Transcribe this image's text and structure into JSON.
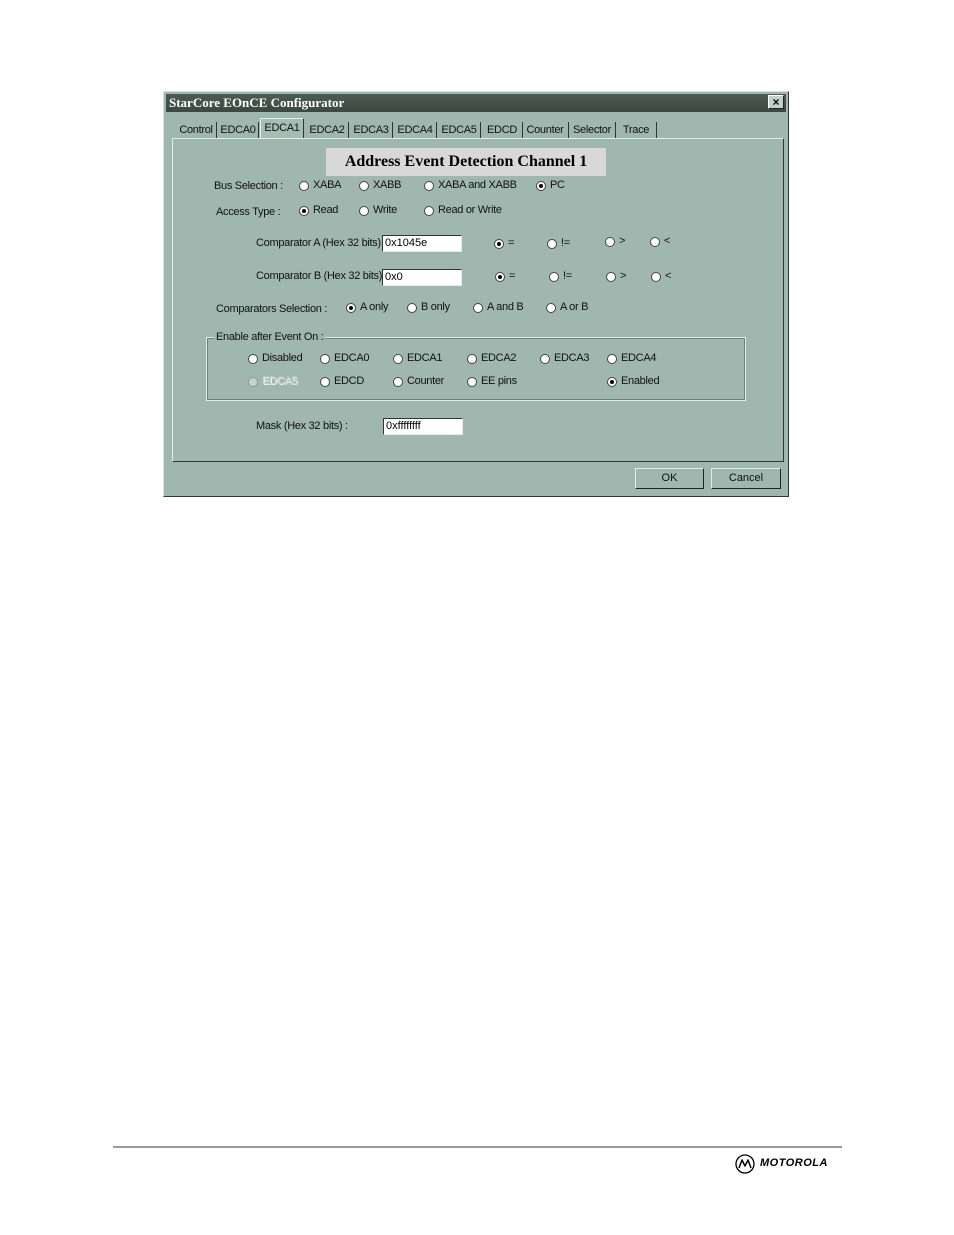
{
  "window": {
    "title": "StarCore EOnCE Configurator",
    "close_label": "×"
  },
  "tabs": [
    {
      "label": "Control",
      "active": false
    },
    {
      "label": "EDCA0",
      "active": false
    },
    {
      "label": "EDCA1",
      "active": true
    },
    {
      "label": "EDCA2",
      "active": false
    },
    {
      "label": "EDCA3",
      "active": false
    },
    {
      "label": "EDCA4",
      "active": false
    },
    {
      "label": "EDCA5",
      "active": false
    },
    {
      "label": "EDCD",
      "active": false
    },
    {
      "label": "Counter",
      "active": false
    },
    {
      "label": "Selector",
      "active": false
    },
    {
      "label": "Trace",
      "active": false
    }
  ],
  "panel": {
    "title": "Address Event Detection Channel 1",
    "bus_selection": {
      "label": "Bus Selection :",
      "options": [
        "XABA",
        "XABB",
        "XABA and XABB",
        "PC"
      ],
      "selected": "PC"
    },
    "access_type": {
      "label": "Access Type :",
      "options": [
        "Read",
        "Write",
        "Read or Write"
      ],
      "selected": "Read"
    },
    "comparator_a": {
      "label": "Comparator A (Hex 32 bits) :",
      "value": "0x1045e",
      "ops": [
        "=",
        "!=",
        ">",
        "<"
      ],
      "selected": "="
    },
    "comparator_b": {
      "label": "Comparator B (Hex 32 bits) :",
      "value": "0x0",
      "ops": [
        "=",
        "!=",
        ">",
        "<"
      ],
      "selected": "="
    },
    "comparators_selection": {
      "label": "Comparators Selection :",
      "options": [
        "A only",
        "B only",
        "A and B",
        "A or B"
      ],
      "selected": "A only"
    },
    "enable_after_event": {
      "label": "Enable after Event On :",
      "row1": [
        "Disabled",
        "EDCA0",
        "EDCA1",
        "EDCA2",
        "EDCA3",
        "EDCA4"
      ],
      "row2": [
        "EDCA5",
        "EDCD",
        "Counter",
        "EE pins",
        "Enabled"
      ],
      "selected": "Enabled",
      "disabled_options": [
        "EDCA5"
      ]
    },
    "mask": {
      "label": "Mask (Hex 32 bits) :",
      "value": "0xffffffff"
    }
  },
  "buttons": {
    "ok": "OK",
    "cancel": "Cancel"
  },
  "footer": {
    "brand": "MOTOROLA"
  }
}
